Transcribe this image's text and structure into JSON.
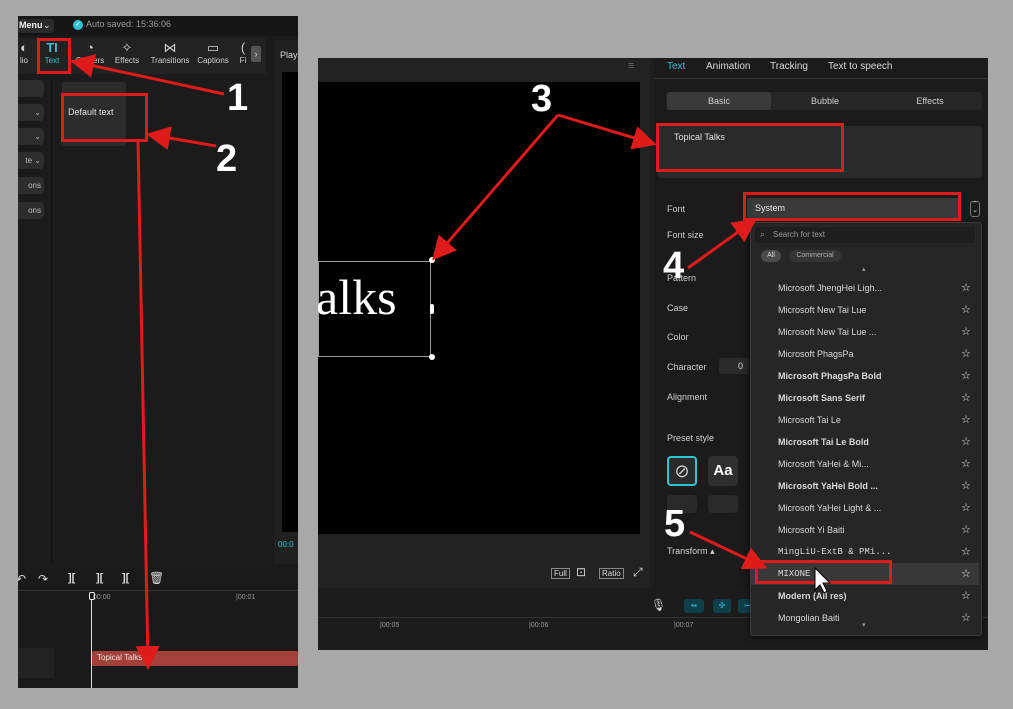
{
  "left": {
    "menu_label": "Menu",
    "autosave": "Auto saved: 15:36:06",
    "tools": [
      {
        "label": "lio",
        "icon": "audio-icon"
      },
      {
        "label": "Text",
        "icon": "text-icon"
      },
      {
        "label": "Stickers",
        "icon": "stickers-icon"
      },
      {
        "label": "Effects",
        "icon": "effects-icon"
      },
      {
        "label": "Transitions",
        "icon": "transitions-icon"
      },
      {
        "label": "Captions",
        "icon": "captions-icon"
      },
      {
        "label": "Fi",
        "icon": "filters-icon"
      }
    ],
    "side_items": [
      "",
      "",
      "",
      "te",
      "ons",
      "ons"
    ],
    "default_text": "Default text",
    "player_label": "Play",
    "player_time": "00:0",
    "timeline_times": [
      "00:00",
      "|00:01"
    ],
    "clip_label": "Topical Talks"
  },
  "right": {
    "preview_text": "alks",
    "tabs": [
      "Text",
      "Animation",
      "Tracking",
      "Text to speech"
    ],
    "subtabs": [
      "Basic",
      "Bubble",
      "Effects"
    ],
    "text_value": "Topical Talks",
    "props": {
      "font": "Font",
      "font_size": "Font size",
      "pattern": "Pattern",
      "case": "Case",
      "color": "Color",
      "character": "Character",
      "character_value": "0",
      "alignment": "Alignment",
      "preset_style": "Preset style",
      "transform": "Transform"
    },
    "font_value": "System",
    "search_placeholder": "Search for text",
    "filter_all": "All",
    "filter_commercial": "Commercial",
    "font_list": [
      "Microsoft JhengHei Ligh...",
      "Microsoft New Tai Lue",
      "Microsoft New Tai Lue ...",
      "Microsoft PhagsPa",
      "Microsoft PhagsPa Bold",
      "Microsoft Sans Serif",
      "Microsoft Tai Le",
      "Microsoft Tai Le Bold",
      "Microsoft YaHei & Mi...",
      "Microsoft YaHei Bold ...",
      "Microsoft YaHei Light & ...",
      "Microsoft Yi Baiti",
      "MingLiU-ExtB & PMi...",
      "MIXONE",
      "Modern (All res)",
      "Mongolian Baiti"
    ],
    "viewer_buttons": [
      "Full",
      "Ratio"
    ],
    "timeline_times": [
      "|00:05",
      "|00:06",
      "|00:07"
    ],
    "preset_aa": "Aa"
  },
  "annotations": [
    "1",
    "2",
    "3",
    "4",
    "5"
  ],
  "colors": {
    "accent": "#2ec4d4",
    "annotation": "#e01b1b",
    "clip": "#a3403b"
  }
}
